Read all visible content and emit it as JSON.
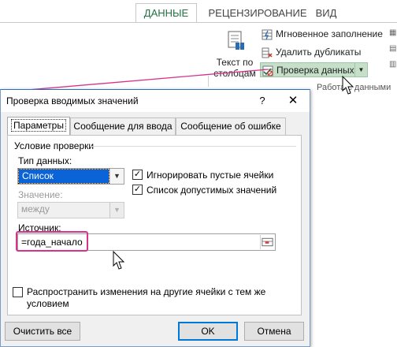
{
  "ribbon": {
    "tabs": [
      {
        "label": "ДАННЫЕ",
        "active": true
      },
      {
        "label": "РЕЦЕНЗИРОВАНИЕ",
        "active": false
      },
      {
        "label": "ВИД",
        "active": false
      }
    ],
    "text_to_columns": "Текст по столбцам",
    "flash_fill": "Мгновенное заполнение",
    "remove_duplicates": "Удалить дубликаты",
    "data_validation": "Проверка данных",
    "group_label": "Работа с данными",
    "accent_color": "#217346"
  },
  "dialog": {
    "title": "Проверка вводимых значений",
    "help_glyph": "?",
    "close_glyph": "✕",
    "tabs": [
      "Параметры",
      "Сообщение для ввода",
      "Сообщение об ошибке"
    ],
    "group_title": "Условие проверки",
    "data_type_label": "Тип данных:",
    "data_type_value": "Список",
    "ignore_blank": {
      "label": "Игнорировать пустые ячейки",
      "checked": true
    },
    "in_cell_dropdown": {
      "label": "Список допустимых значений",
      "checked": true
    },
    "value_label": "Значение:",
    "value_value": "между",
    "source_label": "Источник:",
    "source_value": "=года_начало",
    "apply_all": {
      "label": "Распространить изменения на другие ячейки с тем же условием",
      "checked": false
    },
    "clear_all": "Очистить все",
    "ok": "OK",
    "cancel": "Отмена",
    "highlight_color": "#d6338d",
    "selection_color": "#0a64d8"
  }
}
